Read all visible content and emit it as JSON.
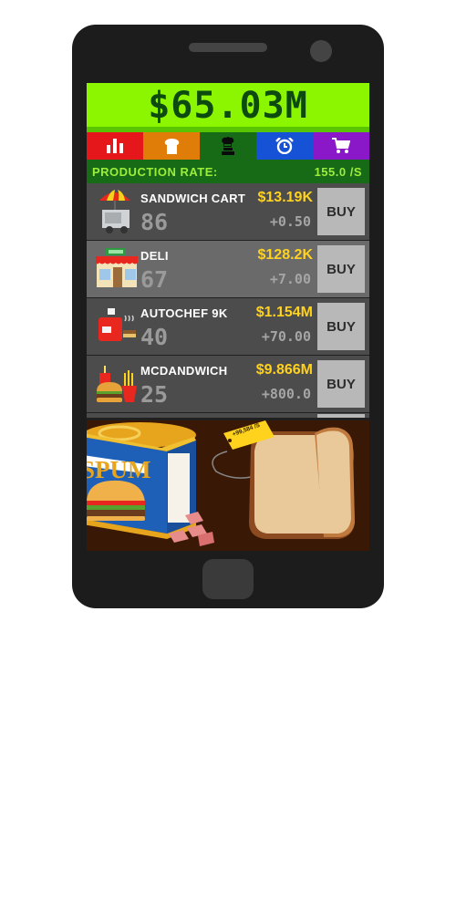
{
  "money": "$65.03M",
  "tabs": [
    {
      "name": "stats",
      "icon": "bar-chart-icon",
      "color": "#e5171a"
    },
    {
      "name": "bread",
      "icon": "bread-icon",
      "color": "#e07d08"
    },
    {
      "name": "producers",
      "icon": "chef-icon",
      "color": "#176b17"
    },
    {
      "name": "alarm",
      "icon": "alarm-clock-icon",
      "color": "#1552d6"
    },
    {
      "name": "shop",
      "icon": "cart-icon",
      "color": "#8a17c8"
    }
  ],
  "production": {
    "label": "PRODUCTION RATE:",
    "value": "155.0 /S"
  },
  "producers": [
    {
      "name": "SANDWICH CART",
      "price": "$13.19K",
      "count": "86",
      "rate": "+0.50",
      "buy": "BUY",
      "icon": "sandwich-cart-icon"
    },
    {
      "name": "DELI",
      "price": "$128.2K",
      "count": "67",
      "rate": "+7.00",
      "buy": "BUY",
      "icon": "deli-icon"
    },
    {
      "name": "AUTOCHEF 9K",
      "price": "$1.154M",
      "count": "40",
      "rate": "+70.00",
      "buy": "BUY",
      "icon": "autochef-icon"
    },
    {
      "name": "MCDANDWICH",
      "price": "$9.866M",
      "count": "25",
      "rate": "+800.0",
      "buy": "BUY",
      "icon": "burger-fries-icon"
    }
  ],
  "scene": {
    "can_label": "SPUM",
    "bonus_tag": "+99,584 /S"
  }
}
